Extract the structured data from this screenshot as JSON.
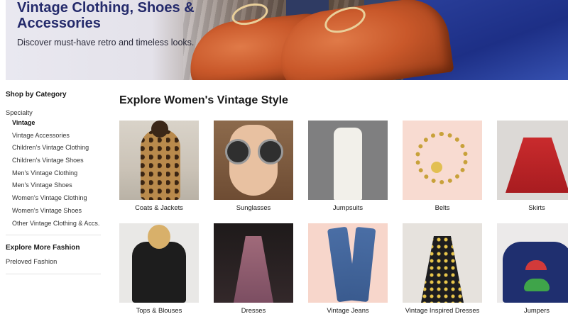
{
  "hero": {
    "title": "Vintage Clothing, Shoes & Accessories",
    "subtitle": "Discover must-have retro and timeless looks."
  },
  "sidebar": {
    "heading": "Shop by Category",
    "section": "Specialty",
    "items": [
      {
        "label": "Vintage",
        "active": true
      },
      {
        "label": "Vintage Accessories"
      },
      {
        "label": "Children's Vintage Clothing"
      },
      {
        "label": "Children's Vintage Shoes"
      },
      {
        "label": "Men's Vintage Clothing"
      },
      {
        "label": "Men's Vintage Shoes"
      },
      {
        "label": "Women's Vintage Clothing"
      },
      {
        "label": "Women's Vintage Shoes"
      },
      {
        "label": "Other Vintage Clothing & Accs."
      }
    ],
    "more_heading": "Explore More Fashion",
    "more_link": "Preloved Fashion"
  },
  "main": {
    "title": "Explore Women's Vintage Style",
    "tiles": [
      {
        "label": "Coats & Jackets"
      },
      {
        "label": "Sunglasses"
      },
      {
        "label": "Jumpsuits"
      },
      {
        "label": "Belts"
      },
      {
        "label": "Skirts"
      },
      {
        "label": "Tops & Blouses"
      },
      {
        "label": "Dresses"
      },
      {
        "label": "Vintage Jeans"
      },
      {
        "label": "Vintage Inspired Dresses"
      },
      {
        "label": "Jumpers"
      }
    ]
  }
}
